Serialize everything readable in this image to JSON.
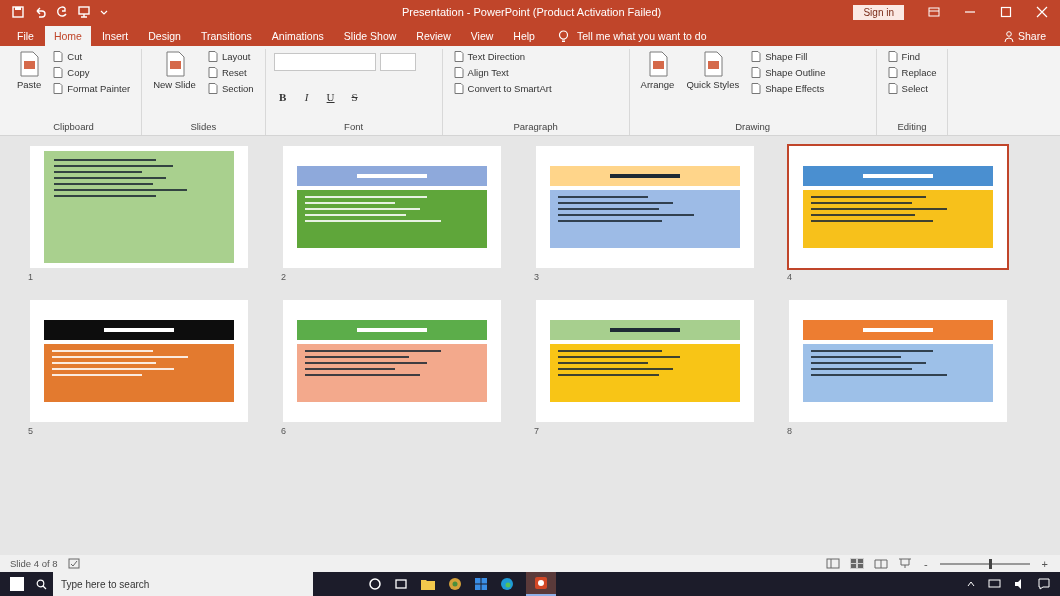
{
  "window": {
    "title": "Presentation - PowerPoint (Product Activation Failed)",
    "sign_in": "Sign in"
  },
  "tabs": [
    {
      "label": "File",
      "selected": false
    },
    {
      "label": "Home",
      "selected": true
    },
    {
      "label": "Insert",
      "selected": false
    },
    {
      "label": "Design",
      "selected": false
    },
    {
      "label": "Transitions",
      "selected": false
    },
    {
      "label": "Animations",
      "selected": false
    },
    {
      "label": "Slide Show",
      "selected": false
    },
    {
      "label": "Review",
      "selected": false
    },
    {
      "label": "View",
      "selected": false
    },
    {
      "label": "Help",
      "selected": false
    }
  ],
  "tell_me": {
    "placeholder": "Tell me what you want to do"
  },
  "share": "Share",
  "ribbon": [
    {
      "label": "Clipboard",
      "items": [
        {
          "label": "Paste",
          "kind": "large"
        },
        {
          "label": "Cut",
          "kind": "small"
        },
        {
          "label": "Copy",
          "kind": "small"
        },
        {
          "label": "Format Painter",
          "kind": "small"
        }
      ]
    },
    {
      "label": "Slides",
      "items": [
        {
          "label": "New Slide",
          "kind": "large"
        },
        {
          "label": "Layout",
          "kind": "small"
        },
        {
          "label": "Reset",
          "kind": "small"
        },
        {
          "label": "Section",
          "kind": "small"
        }
      ]
    },
    {
      "label": "Font",
      "items": [
        {
          "label": "B",
          "kind": "format"
        },
        {
          "label": "I",
          "kind": "format"
        },
        {
          "label": "U",
          "kind": "format"
        },
        {
          "label": "S",
          "kind": "format"
        }
      ]
    },
    {
      "label": "Paragraph",
      "items": [
        {
          "label": "Text Direction",
          "kind": "small"
        },
        {
          "label": "Align Text",
          "kind": "small"
        },
        {
          "label": "Convert to SmartArt",
          "kind": "small"
        }
      ]
    },
    {
      "label": "Drawing",
      "items": [
        {
          "label": "Arrange",
          "kind": "large"
        },
        {
          "label": "Quick Styles",
          "kind": "large"
        },
        {
          "label": "Shape Fill",
          "kind": "small"
        },
        {
          "label": "Shape Outline",
          "kind": "small"
        },
        {
          "label": "Shape Effects",
          "kind": "small"
        }
      ]
    },
    {
      "label": "Editing",
      "items": [
        {
          "label": "Find",
          "kind": "small"
        },
        {
          "label": "Replace",
          "kind": "small"
        },
        {
          "label": "Select",
          "kind": "small"
        }
      ]
    }
  ],
  "slides": [
    {
      "number": "1",
      "selected": false,
      "kind": "full",
      "body": {
        "color": "#a9d08e"
      }
    },
    {
      "number": "2",
      "selected": false,
      "kind": "header",
      "header": {
        "color": "#8ea9db"
      },
      "body": {
        "color": "#5fa63a"
      }
    },
    {
      "number": "3",
      "selected": false,
      "kind": "header",
      "header": {
        "color": "#ffd58a"
      },
      "body": {
        "color": "#9dbbe6"
      }
    },
    {
      "number": "4",
      "selected": true,
      "kind": "header",
      "header": {
        "color": "#4a8fd0"
      },
      "body": {
        "color": "#f7c11b"
      }
    },
    {
      "number": "5",
      "selected": false,
      "kind": "header",
      "header": {
        "color": "#0d0d0d"
      },
      "body": {
        "color": "#e37a2f"
      }
    },
    {
      "number": "6",
      "selected": false,
      "kind": "header",
      "header": {
        "color": "#5cad4a"
      },
      "body": {
        "color": "#f3a98c"
      }
    },
    {
      "number": "7",
      "selected": false,
      "kind": "header",
      "header": {
        "color": "#a7cf8e"
      },
      "body": {
        "color": "#f8c516"
      }
    },
    {
      "number": "8",
      "selected": false,
      "kind": "header",
      "header": {
        "color": "#ed7d31"
      },
      "body": {
        "color": "#9dc0e8"
      }
    }
  ],
  "status_bar": {
    "slide_info": "Slide 4 of 8",
    "zoom_out": "-",
    "zoom_in": "+",
    "zoom": {
      "level": 0.55
    }
  },
  "taskbar": {
    "search": {
      "placeholder": "Type here to search"
    }
  }
}
